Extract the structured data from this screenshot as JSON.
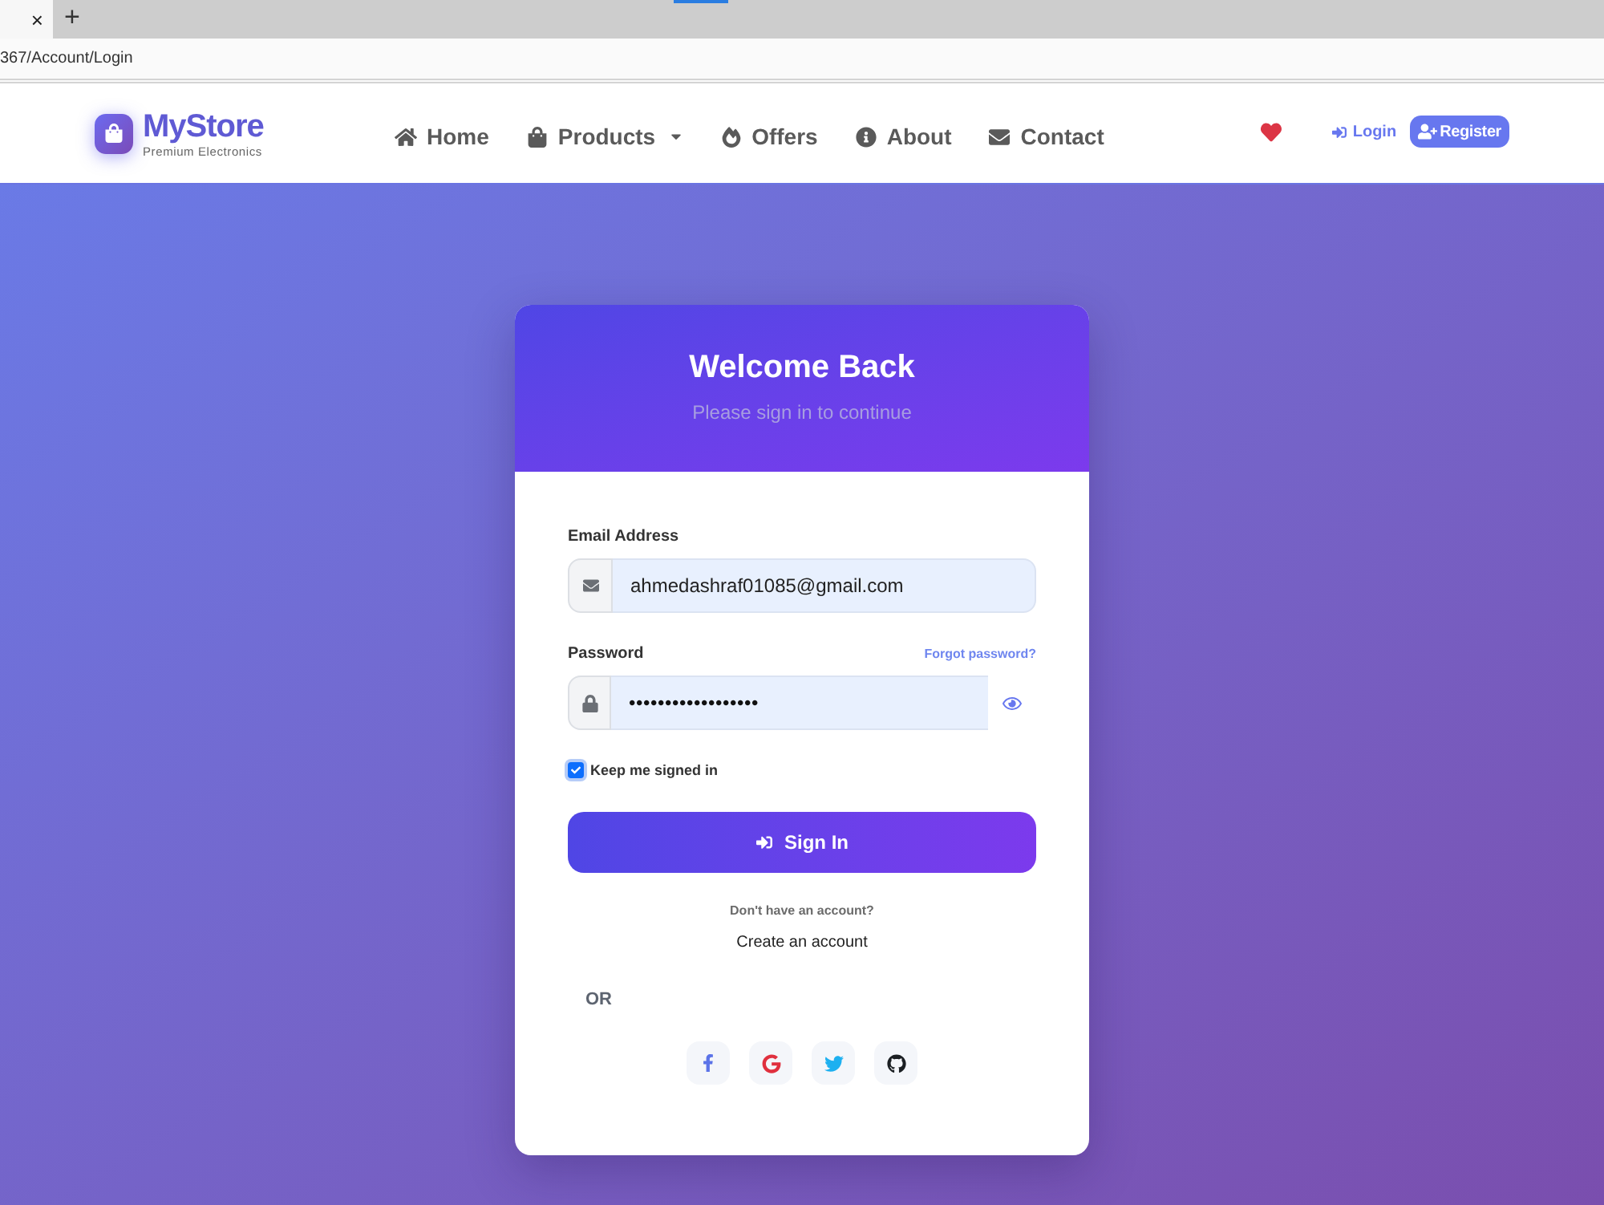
{
  "browser": {
    "tab": {
      "close": "×"
    },
    "new_tab": "+",
    "address": "367/Account/Login"
  },
  "navbar": {
    "brand": {
      "name": "MyStore",
      "tagline": "Premium Electronics"
    },
    "links": [
      {
        "label": "Home",
        "kind": "link"
      },
      {
        "label": "Products",
        "kind": "dropdown"
      },
      {
        "label": "Offers",
        "kind": "link"
      },
      {
        "label": "About",
        "kind": "link"
      },
      {
        "label": "Contact",
        "kind": "link"
      }
    ],
    "login": "Login",
    "register": "Register"
  },
  "login_card": {
    "title": "Welcome Back",
    "subtitle": "Please sign in to continue",
    "email": {
      "label": "Email Address",
      "value": "ahmedashraf01085@gmail.com"
    },
    "password": {
      "label": "Password",
      "value": "••••••••••••••••••",
      "forgot": "Forgot password?"
    },
    "remember": {
      "label": "Keep me signed in",
      "checked": true
    },
    "submit": "Sign In",
    "signup_prompt": "Don't have an account?",
    "signup_link": "Create an account",
    "divider": "OR",
    "social": [
      {
        "kind": "facebook"
      },
      {
        "kind": "google"
      },
      {
        "kind": "twitter"
      },
      {
        "kind": "github"
      }
    ]
  }
}
